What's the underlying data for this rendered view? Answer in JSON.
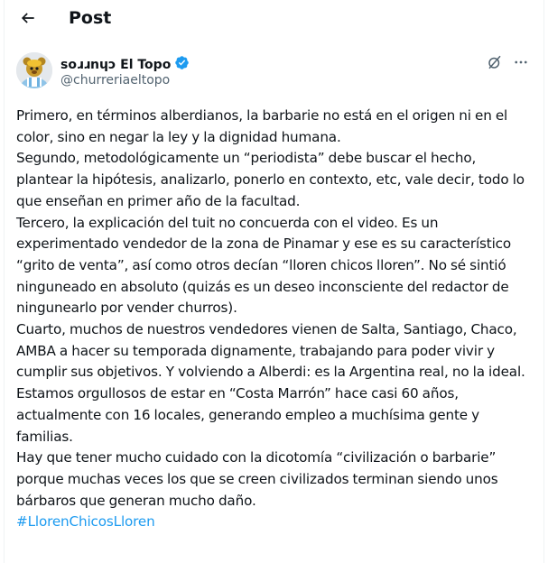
{
  "header": {
    "back_icon": "arrow-left-icon",
    "title": "Post"
  },
  "author": {
    "display_name": "ꜱoɹɹnɥɔ El Topo",
    "handle": "@churreriaeltopo",
    "verified_icon": "verified-badge-icon",
    "verified_color": "#1d9bf0"
  },
  "actions": {
    "grok_icon": "grok-icon",
    "more_icon": "more-horizontal-icon"
  },
  "post": {
    "paragraphs": [
      "Primero,  en términos alberdianos, la barbarie no está en el origen ni en el color, sino en negar la ley y la dignidad humana.",
      "Segundo, metodológicamente un “periodista” debe buscar el hecho, plantear la hipótesis, analizarlo, ponerlo en contexto, etc, vale decir, todo lo que enseñan en primer año de la facultad.",
      "Tercero, la explicación del tuit no concuerda con el video. Es un experimentado vendedor de la zona de Pinamar y ese es su característico “grito de venta”, así como otros decían “lloren chicos lloren”. No sé sintió ninguneado en absoluto (quizás es un deseo inconsciente del redactor de ningunearlo por vender churros).",
      "Cuarto, muchos de nuestros vendedores vienen de Salta, Santiago, Chaco, AMBA a hacer su temporada dignamente, trabajando para poder vivir y cumplir sus objetivos. Y volviendo a Alberdi: es la Argentina real, no la ideal.",
      "Estamos orgullosos de estar en “Costa Marrón” hace casi 60 años, actualmente con 16 locales, generando empleo a muchísima gente y familias.",
      "Hay que tener mucho cuidado con la dicotomía “civilización o barbarie” porque muchas veces los que se creen civilizados terminan siendo unos bárbaros que generan mucho daño."
    ],
    "hashtag": "#LlorenChicosLloren",
    "link_color": "#1d9bf0"
  }
}
